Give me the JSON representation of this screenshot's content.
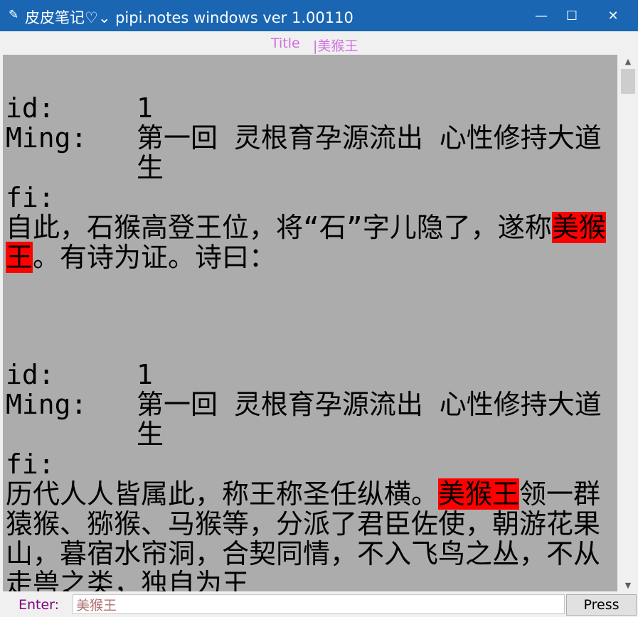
{
  "window": {
    "title": "皮皮笔记♡⌄ pipi.notes windows ver 1.00110",
    "icon": "quill-icon",
    "minimize_glyph": "—",
    "maximize_glyph": "☐",
    "close_glyph": "✕"
  },
  "header": {
    "title_label": "Title",
    "title_value": "|美猴王"
  },
  "notes": [
    {
      "id_key": "id:",
      "id_value": "1",
      "ming_key": "Ming:",
      "ming_value": "第一回 灵根育孕源流出 心性修持大道生",
      "fi_key": "fi:",
      "text_before": "自此，石猴高登王位，将“石”字儿隐了，遂称",
      "highlight": "美猴王",
      "text_after": "。有诗为证。诗曰："
    },
    {
      "id_key": "id:",
      "id_value": "1",
      "ming_key": "Ming:",
      "ming_value": "第一回 灵根育孕源流出 心性修持大道生",
      "fi_key": "fi:",
      "text_before": "历代人人皆属此，称王称圣任纵横。",
      "highlight": "美猴王",
      "text_after": "领一群猿猴、猕猴、马猴等，分派了君臣佐使，朝游花果山，暮宿水帘洞，合契同情，不入飞鸟之丛，不从走兽之类，独自为王"
    }
  ],
  "scrollbar": {
    "up_glyph": "▲",
    "down_glyph": "▼"
  },
  "footer": {
    "enter_label": "Enter:",
    "input_value": "美猴王",
    "press_label": "Press"
  },
  "colors": {
    "titlebar": "#1a66b3",
    "title_text": "#d070e0",
    "content_bg": "#acacac",
    "highlight": "#ff0000",
    "enter_label": "#800080"
  }
}
